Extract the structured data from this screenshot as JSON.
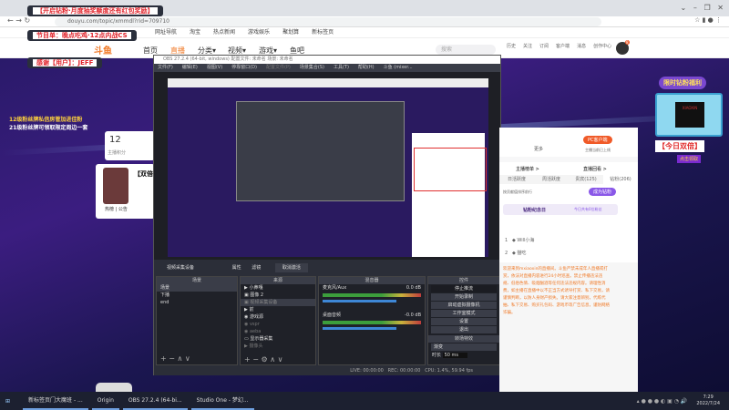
{
  "browser": {
    "url": "douyu.com/topic/xmmdl?rid=709710",
    "bookmarks": [
      "网址导航",
      "淘宝",
      "热点新闻",
      "游戏娱乐",
      "聚划算",
      "新标签页"
    ]
  },
  "overlays": {
    "line1": "【开启钻粉·月度抽奖额度还有红包奖励】",
    "line2": "节目单：晚点吃鸡·12点内战CS",
    "line3": "感谢【用户】：JEFF",
    "notice1": "12级粉丝牌私信房管加进佳粉",
    "notice2": "21级粉丝牌可领取限定周边一套"
  },
  "site": {
    "logo": "斗鱼",
    "nav": [
      "首页",
      "直播",
      "分类▾",
      "视频▾",
      "游戏▾",
      "鱼吧"
    ],
    "search_placeholder": "搜索",
    "icons": [
      "历史",
      "关注",
      "订阅",
      "客户端",
      "消息",
      "创作中心"
    ],
    "notif_badge": "8"
  },
  "left_card": {
    "score": "12",
    "score_label": "主播积分",
    "title": "【双倍",
    "tags": [
      "热榜",
      "公告"
    ]
  },
  "obs": {
    "title": "OBS 27.2.4 (64-bit, windows)  配置文件: 未命名  场景: 未命名",
    "menu": [
      "文件(F)",
      "编辑(E)",
      "视图(V)",
      "停靠窗口(D)",
      "配置文件(P)",
      "场景集合(S)",
      "工具(T)",
      "帮助(H)",
      "斗鱼 (mixer..."
    ],
    "source_bar": {
      "current": "视频采集设备",
      "props": "属性",
      "filters": "滤镜",
      "deactivate": "取消激活"
    },
    "docks": {
      "scenes": "场景",
      "sources": "来源",
      "mixer": "混音器",
      "controls": "控件",
      "transitions": "转场特效"
    },
    "scenes": [
      "场景",
      "下播",
      "end"
    ],
    "sources": [
      "小鼻嘎",
      "图像 2",
      "视频采集设备",
      "前",
      "游戏源",
      "vspr",
      "aeba",
      "显示器采集",
      "摄像头"
    ],
    "mixer": [
      {
        "name": "麦克风/Aux",
        "db": "0.0 dB"
      },
      {
        "name": "桌面音频",
        "db": "-0.0 dB"
      }
    ],
    "controls": [
      "停止推流",
      "开始录制",
      "启动虚拟摄像机",
      "工作室模式",
      "设置",
      "退出"
    ],
    "transition": "渐变",
    "duration_label": "时长",
    "duration": "50 ms",
    "status": {
      "live": "LIVE: 00:00:00",
      "rec": "REC: 00:00:00",
      "cpu": "CPU: 1.4%, 59.94 fps"
    }
  },
  "right_panel": {
    "more": "更多",
    "pc_btn": "PC客户端",
    "pc_sub": "主播当前已上线",
    "anchor_rank": "主播榜单 >",
    "live_replay": "直播回看 >",
    "tabs": [
      "日活跃度",
      "周活跃度",
      "贵宾(125)",
      "钻粉(206)"
    ],
    "hint": "按贡献值排序前行",
    "become": "成为钻粉",
    "day_title": "钻粉纪念日",
    "day_count": "今日共有0位粉丝",
    "fans": [
      {
        "rank": "1",
        "name": "Will小海"
      },
      {
        "rank": "2",
        "name": "猫吃"
      }
    ],
    "notice": "欢迎来到mxiaoxin的直播间。斗鱼严禁未成年人直播或打赏，依法对直播内容进行24小时巡查。禁止传播违法违规、低俗色情、吸烟酗酒等任何违法违规内容。请理性消费，如主播在直播中以不正当方式诱导打赏、私下交易，请谨慎判断，以防人身财产损失。请大家注意辨别，代练代抽、私下交易、购买礼包码、游戏币等广告信息，谨防网络诈骗。"
  },
  "promo": {
    "title": "限时钻粉福利",
    "brand": "XIAOXIN",
    "today": "【今日双倍】",
    "sub": "点击领取"
  },
  "taskbar": {
    "apps": [
      "新标签页门大魔班 - ...",
      "Origin",
      "OBS 27.2.4 (64-bi...",
      "Studio One - 梦幻..."
    ],
    "time": "7:29",
    "date": "2022/7/24"
  }
}
